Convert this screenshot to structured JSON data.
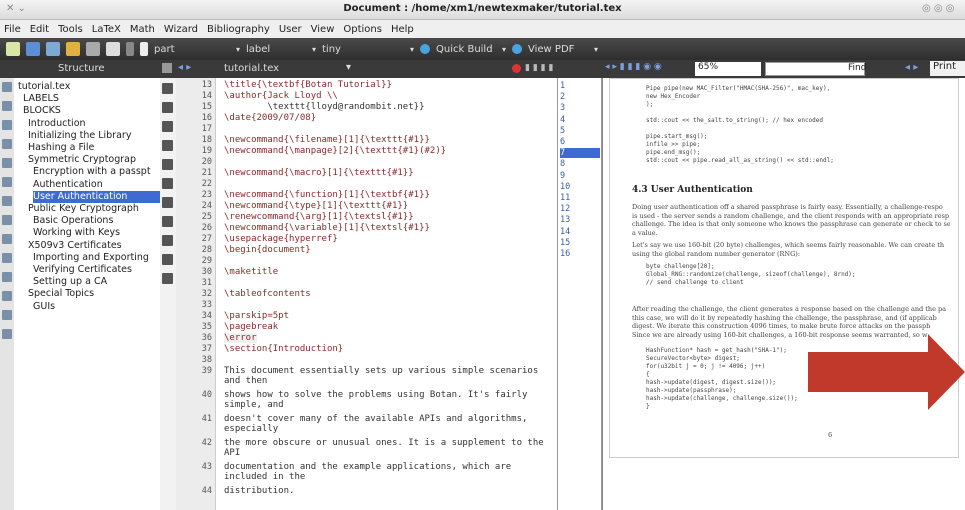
{
  "window": {
    "title": "Document : /home/xm1/newtexmaker/tutorial.tex"
  },
  "menu": [
    "File",
    "Edit",
    "Tools",
    "LaTeX",
    "Math",
    "Wizard",
    "Bibliography",
    "User",
    "View",
    "Options",
    "Help"
  ],
  "toolbar": {
    "part_label": "part",
    "label_label": "label",
    "size_label": "tiny",
    "quick_build": "Quick Build",
    "view_pdf": "View PDF"
  },
  "panels": {
    "structure_title": "Structure",
    "editor_tab": "tutorial.tex",
    "zoom": "65%",
    "find_label": "Find",
    "print_label": "Print"
  },
  "structure": [
    {
      "label": "tutorial.tex",
      "indent": 0
    },
    {
      "label": "LABELS",
      "indent": 1
    },
    {
      "label": "BLOCKS",
      "indent": 1
    },
    {
      "label": "Introduction",
      "indent": 2
    },
    {
      "label": "Initializing the Library",
      "indent": 2
    },
    {
      "label": "Hashing a File",
      "indent": 2
    },
    {
      "label": "Symmetric Cryptograp",
      "indent": 2
    },
    {
      "label": "Encryption with a passpt",
      "indent": 3
    },
    {
      "label": "Authentication",
      "indent": 3
    },
    {
      "label": "User Authentication",
      "indent": 3,
      "selected": true
    },
    {
      "label": "Public Key Cryptograph",
      "indent": 2
    },
    {
      "label": "Basic Operations",
      "indent": 3
    },
    {
      "label": "Working with Keys",
      "indent": 3
    },
    {
      "label": "X509v3 Certificates",
      "indent": 2
    },
    {
      "label": "Importing and Exporting",
      "indent": 3
    },
    {
      "label": "Verifying Certificates",
      "indent": 3
    },
    {
      "label": "Setting up a CA",
      "indent": 3
    },
    {
      "label": "Special Topics",
      "indent": 2
    },
    {
      "label": "GUIs",
      "indent": 3
    }
  ],
  "editor_lines": [
    {
      "n": "13",
      "text": "\\title{\\textbf{Botan Tutorial}}"
    },
    {
      "n": "14",
      "text": "\\author{Jack Lloyd \\\\"
    },
    {
      "n": "15",
      "text": "        \\texttt{lloyd@randombit.net}}"
    },
    {
      "n": "16",
      "text": "\\date{2009/07/08}"
    },
    {
      "n": "17",
      "text": ""
    },
    {
      "n": "18",
      "text": "\\newcommand{\\filename}[1]{\\texttt{#1}}"
    },
    {
      "n": "19",
      "text": "\\newcommand{\\manpage}[2]{\\texttt{#1}(#2)}"
    },
    {
      "n": "20",
      "text": ""
    },
    {
      "n": "21",
      "text": "\\newcommand{\\macro}[1]{\\texttt{#1}}"
    },
    {
      "n": "22",
      "text": ""
    },
    {
      "n": "23",
      "text": "\\newcommand{\\function}[1]{\\textbf{#1}}"
    },
    {
      "n": "24",
      "text": "\\newcommand{\\type}[1]{\\texttt{#1}}"
    },
    {
      "n": "25",
      "text": "\\renewcommand{\\arg}[1]{\\textsl{#1}}"
    },
    {
      "n": "26",
      "text": "\\newcommand{\\variable}[1]{\\textsl{#1}}"
    },
    {
      "n": "27",
      "text": "\\usepackage{hyperref}"
    },
    {
      "n": "28",
      "text": "\\begin{document}"
    },
    {
      "n": "29",
      "text": ""
    },
    {
      "n": "30",
      "text": "\\maketitle"
    },
    {
      "n": "31",
      "text": ""
    },
    {
      "n": "32",
      "text": "\\tableofcontents"
    },
    {
      "n": "33",
      "text": ""
    },
    {
      "n": "34",
      "text": "\\parskip=5pt"
    },
    {
      "n": "35",
      "text": "\\pagebreak"
    },
    {
      "n": "36",
      "text": "\\error"
    },
    {
      "n": "37",
      "text": "\\section{Introduction}"
    },
    {
      "n": "38",
      "text": ""
    },
    {
      "n": "39",
      "text": "This document essentially sets up various simple scenarios\nand then"
    },
    {
      "n": "40",
      "text": "shows how to solve the problems using Botan. It's fairly\nsimple, and"
    },
    {
      "n": "41",
      "text": "doesn't cover many of the available APIs and algorithms,\nespecially"
    },
    {
      "n": "42",
      "text": "the more obscure or unusual ones. It is a supplement to the\nAPI"
    },
    {
      "n": "43",
      "text": "documentation and the example applications, which are\nincluded in the"
    },
    {
      "n": "44",
      "text": "distribution."
    }
  ],
  "ref_list": [
    "1",
    "2",
    "3",
    "4",
    "5",
    "6",
    "7",
    "8",
    "9",
    "10",
    "11",
    "12",
    "13",
    "14",
    "15",
    "16"
  ],
  "pdf": {
    "section_heading": "4.3   User Authentication",
    "code_top": [
      "Pipe pipe(new MAC_Filter(\"HMAC(SHA-256)\", mac_key),",
      "         new Hex_Encoder",
      ");",
      "",
      "std::cout << the_salt.to_string(); // hex encoded",
      "",
      "pipe.start_msg();",
      "infile >> pipe;",
      "pipe.end_msg();",
      "std::cout << pipe.read_all_as_string() << std::endl;"
    ],
    "para1": [
      "Doing user authentication off a shared passphrase is fairly easy. Essentially, a challenge-respo",
      "is used - the server sends a random challenge, and the client responds with an appropriate resp",
      "challenge. The idea is that only someone who knows the passphrase can generate or check to se",
      "a value."
    ],
    "para2": [
      "Let's say we use 160-bit (20 byte) challenges, which seems fairly reasonable. We can create th",
      "using the global random number generator (RNG):"
    ],
    "code_mid": [
      "byte challenge[20];",
      "Global_RNG::randomize(challenge, sizeof(challenge), 8rnd);",
      "// send challenge to client"
    ],
    "para3": [
      "After reading the challenge, the client generates a response based on the challenge and the pa",
      "this case, we will do it by repeatedly hashing the challenge, the passphrase, and (if applicab",
      "digest. We iterate this construction 4096 times, to make brute force attacks on the passph",
      "Since we are already using 160-bit challenges, a 160-bit response seems warranted, so w"
    ],
    "code_bot": [
      "HashFunction* hash = get_hash(\"SHA-1\");",
      "SecureVector<byte> digest;",
      "for(u32bit j = 0; j != 4096; j++)",
      "   {",
      "   hash->update(digest, digest.size());",
      "   hash->update(passphrase);",
      "   hash->update(challenge, challenge.size());",
      "   }"
    ],
    "page_no": "6"
  },
  "colors": {
    "arrow": "#c0392b",
    "selection": "#3d6bd1"
  }
}
